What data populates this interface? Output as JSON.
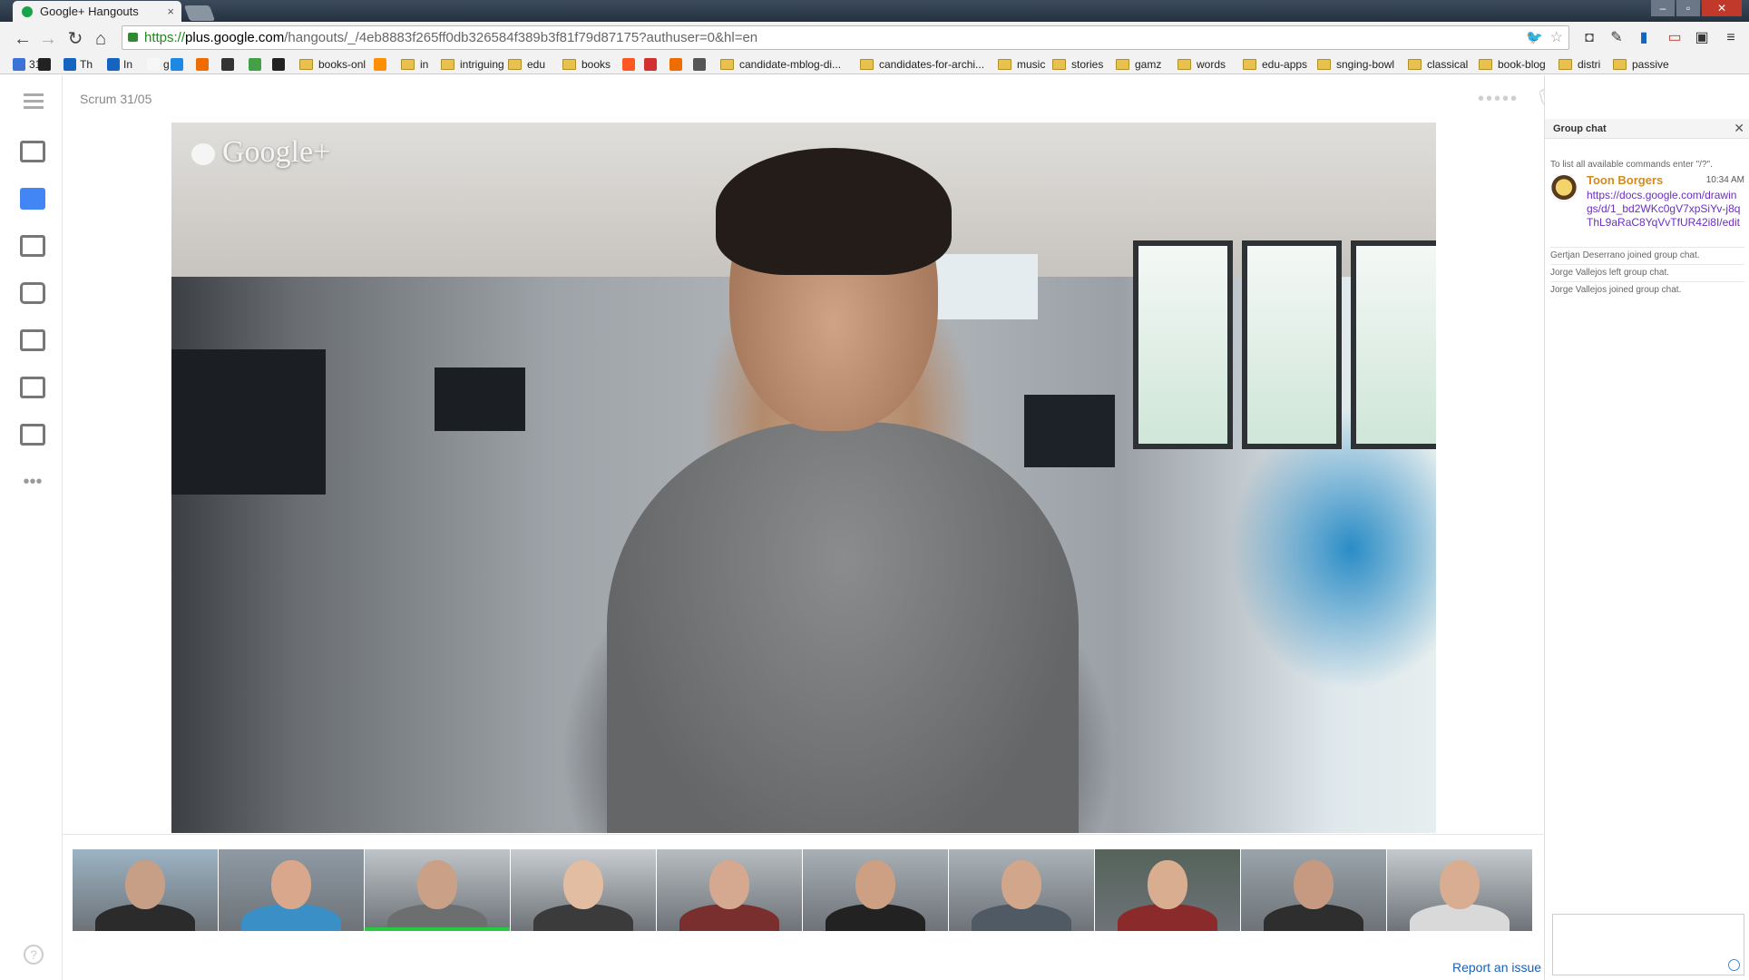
{
  "browser": {
    "tab_title": "Google+ Hangouts",
    "url_scheme": "https://",
    "url_host": "plus.google.com",
    "url_path": "/hangouts/_/4eb8883f265ff0db326584f389b3f81f79d87175?authuser=0&hl=en"
  },
  "bookmarks": [
    {
      "label": "31",
      "type": "icon",
      "color": "#3b73d6"
    },
    {
      "label": "",
      "type": "icon",
      "color": "#222222"
    },
    {
      "label": "Th",
      "type": "icon",
      "color": "#1565c0"
    },
    {
      "label": "In",
      "type": "icon",
      "color": "#1565c0"
    },
    {
      "label": "g",
      "type": "icon",
      "color": "#f7f7f7"
    },
    {
      "label": "",
      "type": "icon",
      "color": "#1e88e5"
    },
    {
      "label": "",
      "type": "icon",
      "color": "#ef6c00"
    },
    {
      "label": "",
      "type": "icon",
      "color": "#333333"
    },
    {
      "label": "",
      "type": "icon",
      "color": "#43a047"
    },
    {
      "label": "",
      "type": "icon",
      "color": "#222222"
    },
    {
      "label": "books-onl",
      "type": "folder"
    },
    {
      "label": "",
      "type": "icon",
      "color": "#ff8f00"
    },
    {
      "label": "in",
      "type": "folder"
    },
    {
      "label": "intriguing",
      "type": "folder"
    },
    {
      "label": "edu",
      "type": "folder"
    },
    {
      "label": "books",
      "type": "folder"
    },
    {
      "label": "",
      "type": "icon",
      "color": "#ff5722"
    },
    {
      "label": "",
      "type": "icon",
      "color": "#d32f2f"
    },
    {
      "label": "",
      "type": "icon",
      "color": "#ef6c00"
    },
    {
      "label": "",
      "type": "icon",
      "color": "#555555"
    },
    {
      "label": "candidate-mblog-di...",
      "type": "folder"
    },
    {
      "label": "candidates-for-archi...",
      "type": "folder"
    },
    {
      "label": "music",
      "type": "folder"
    },
    {
      "label": "stories",
      "type": "folder"
    },
    {
      "label": "gamz",
      "type": "folder"
    },
    {
      "label": "words",
      "type": "folder"
    },
    {
      "label": "edu-apps",
      "type": "folder"
    },
    {
      "label": "snging-bowl",
      "type": "folder"
    },
    {
      "label": "classical",
      "type": "folder"
    },
    {
      "label": "book-blog",
      "type": "folder"
    },
    {
      "label": "distri",
      "type": "folder"
    },
    {
      "label": "passive",
      "type": "folder"
    }
  ],
  "hangout": {
    "title": "Scrum 31/05",
    "video_watermark": "Google+",
    "report_link": "Report an issue",
    "participants": [
      {
        "skin": "#c69f86",
        "shirt": "#2b2b2b",
        "bg": "#9db3c4"
      },
      {
        "skin": "#d9a88c",
        "shirt": "#3a90c6",
        "bg": "#8f9aa4"
      },
      {
        "skin": "#caa086",
        "shirt": "#6d6e70",
        "bg": "#bfc4c8",
        "active": true
      },
      {
        "skin": "#e3bda1",
        "shirt": "#3b3b3b",
        "bg": "#c8ccd0"
      },
      {
        "skin": "#d4a98f",
        "shirt": "#7a2f2f",
        "bg": "#b7bcc0"
      },
      {
        "skin": "#cda084",
        "shirt": "#222222",
        "bg": "#a8b0b6"
      },
      {
        "skin": "#d2a68a",
        "shirt": "#505a64",
        "bg": "#aab2b8"
      },
      {
        "skin": "#d9ad90",
        "shirt": "#8a2a2a",
        "bg": "#55635a"
      },
      {
        "skin": "#c59a80",
        "shirt": "#2e2e2e",
        "bg": "#9aa4ab"
      },
      {
        "skin": "#d8ad92",
        "shirt": "#d9d9d9",
        "bg": "#c3c9cc"
      }
    ]
  },
  "chat": {
    "header": "Group chat",
    "hint": "To list all available commands enter \"/?\".",
    "message": {
      "sender": "Toon Borgers",
      "time": "10:34 AM",
      "link": "https://docs.google.com/drawings/d/1_bd2WKc0gV7xpSiYv-j8qThL9aRaC8YqVvTfUR42i8I/edit"
    },
    "events": [
      "Gertjan Deserrano joined group chat.",
      "Jorge Vallejos left group chat.",
      "Jorge Vallejos joined group chat."
    ]
  },
  "icons": {
    "left_rail": [
      "menu-icon",
      "add-person-icon",
      "chat-icon",
      "screenshare-icon",
      "camera-icon",
      "effects-icon",
      "toolbox-icon",
      "remote-desktop-icon",
      "more-icon"
    ],
    "top_controls": [
      "volume-icon",
      "mute-mic-icon",
      "mute-camera-icon",
      "bandwidth-icon",
      "settings-icon",
      "hangup-icon"
    ]
  }
}
